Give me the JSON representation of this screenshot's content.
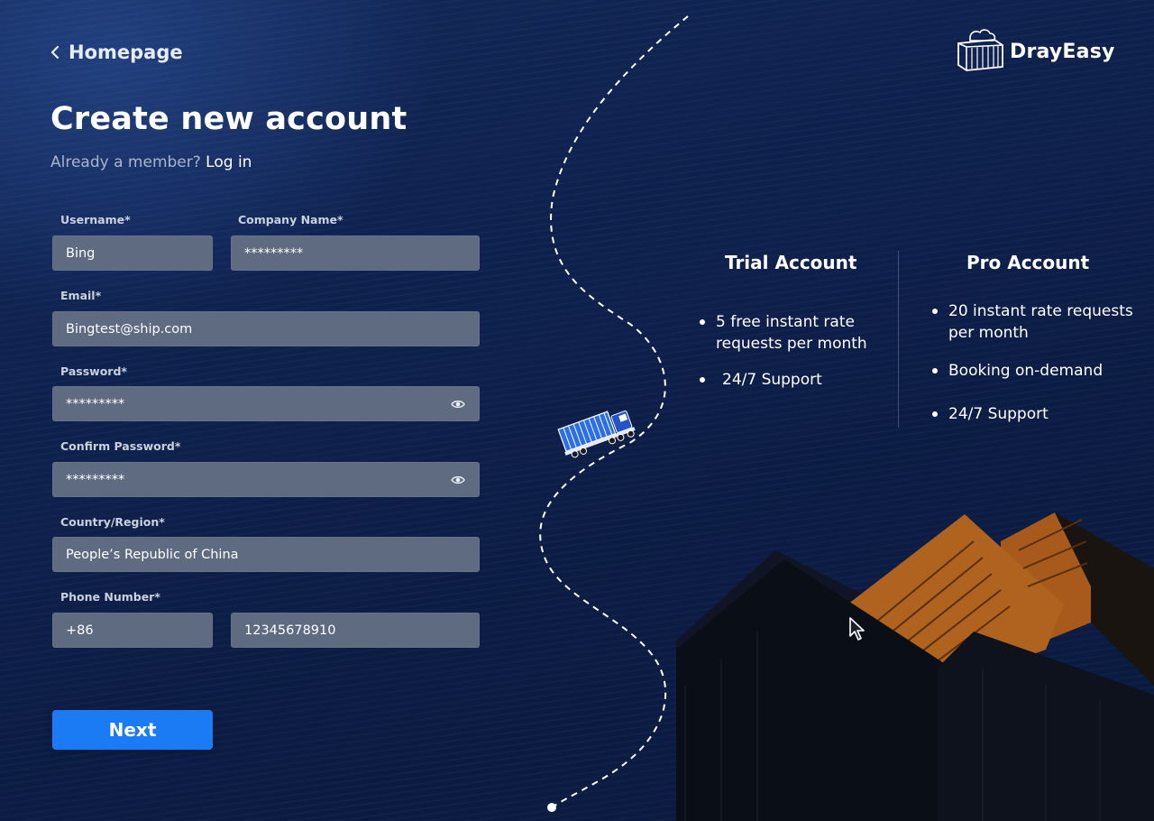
{
  "nav": {
    "back_label": "Homepage"
  },
  "header": {
    "title": "Create new account",
    "member_prompt": "Already a member?",
    "login_link": "Log in"
  },
  "form": {
    "username": {
      "label": "Username*",
      "value": "Bing"
    },
    "company_name": {
      "label": "Company Name*",
      "value": "*********"
    },
    "email": {
      "label": "Email*",
      "value": "Bingtest@ship.com"
    },
    "password": {
      "label": "Password*",
      "value": "*********"
    },
    "confirm_password": {
      "label": "Confirm Password*",
      "value": "*********"
    },
    "country": {
      "label": "Country/Region*",
      "value": "People’s Republic of China"
    },
    "phone": {
      "label": "Phone Number*",
      "code": "+86",
      "number": "12345678910"
    },
    "next_label": "Next"
  },
  "brand": {
    "name": "DrayEasy"
  },
  "accounts": {
    "trial": {
      "title": "Trial Account",
      "features": [
        "5 free instant rate requests per month",
        "24/7 Support"
      ],
      "feature_lines": [
        "5 free instant rate",
        "requests per month"
      ]
    },
    "pro": {
      "title": "Pro Account",
      "features": [
        "20 instant rate requests per month",
        "Booking on-demand",
        "24/7 Support"
      ],
      "feature_lines": [
        "20 instant rate requests",
        "per month"
      ]
    }
  },
  "icons": {
    "back": "chevron-left-icon",
    "eye": "eye-icon",
    "logo": "container-cloud-icon",
    "truck": "truck-icon",
    "cursor": "mouse-pointer-icon"
  },
  "colors": {
    "background": "#0f2250",
    "input": "#5e6b80",
    "accent": "#1a7bf5",
    "container_orange": "#b0631e"
  }
}
